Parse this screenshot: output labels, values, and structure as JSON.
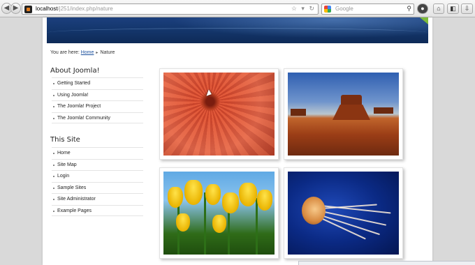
{
  "browser": {
    "url_host": "localhost",
    "url_path": "/j251/index.php/nature",
    "url_icons": "☆ ▾ ↻",
    "search_placeholder": "Google",
    "icons": [
      "back-icon",
      "forward-icon",
      "favicon",
      "google-icon",
      "search-icon",
      "stop-icon",
      "home-icon",
      "bookmarks-icon",
      "download-icon"
    ]
  },
  "breadcrumb": {
    "prefix": "You are here:",
    "home": "Home",
    "separator": "▸",
    "current": "Nature"
  },
  "sidebar": {
    "about_title": "About Joomla!",
    "about_items": [
      "Getting Started",
      "Using Joomla!",
      "The Joomla! Project",
      "The Joomla! Community"
    ],
    "site_title": "This Site",
    "site_items": [
      "Home",
      "Site Map",
      "Login",
      "Sample Sites",
      "Site Administrator",
      "Example Pages"
    ]
  },
  "gallery": {
    "images": [
      "flower",
      "desert",
      "tulips",
      "jellyfish"
    ]
  },
  "colors": {
    "banner": "#15386f",
    "link": "#1a4f9c"
  }
}
